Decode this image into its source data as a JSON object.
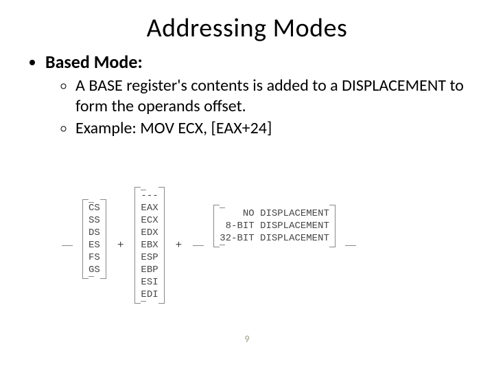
{
  "title": "Addressing Modes",
  "heading": "Based Mode:",
  "bullets": {
    "b1": "A BASE register's contents is added to a DISPLACEMENT to form the operands offset.",
    "b2": "Example: MOV ECX, [EAX+24]"
  },
  "diagram": {
    "segments": [
      "CS",
      "SS",
      "DS",
      "ES",
      "FS",
      "GS"
    ],
    "registers": [
      "---",
      "EAX",
      "ECX",
      "EDX",
      "EBX",
      "ESP",
      "EBP",
      "ESI",
      "EDI"
    ],
    "displacements": [
      "NO DISPLACEMENT",
      "8-BIT DISPLACEMENT",
      "32-BIT DISPLACEMENT"
    ],
    "op": "+"
  },
  "page_number": "9"
}
